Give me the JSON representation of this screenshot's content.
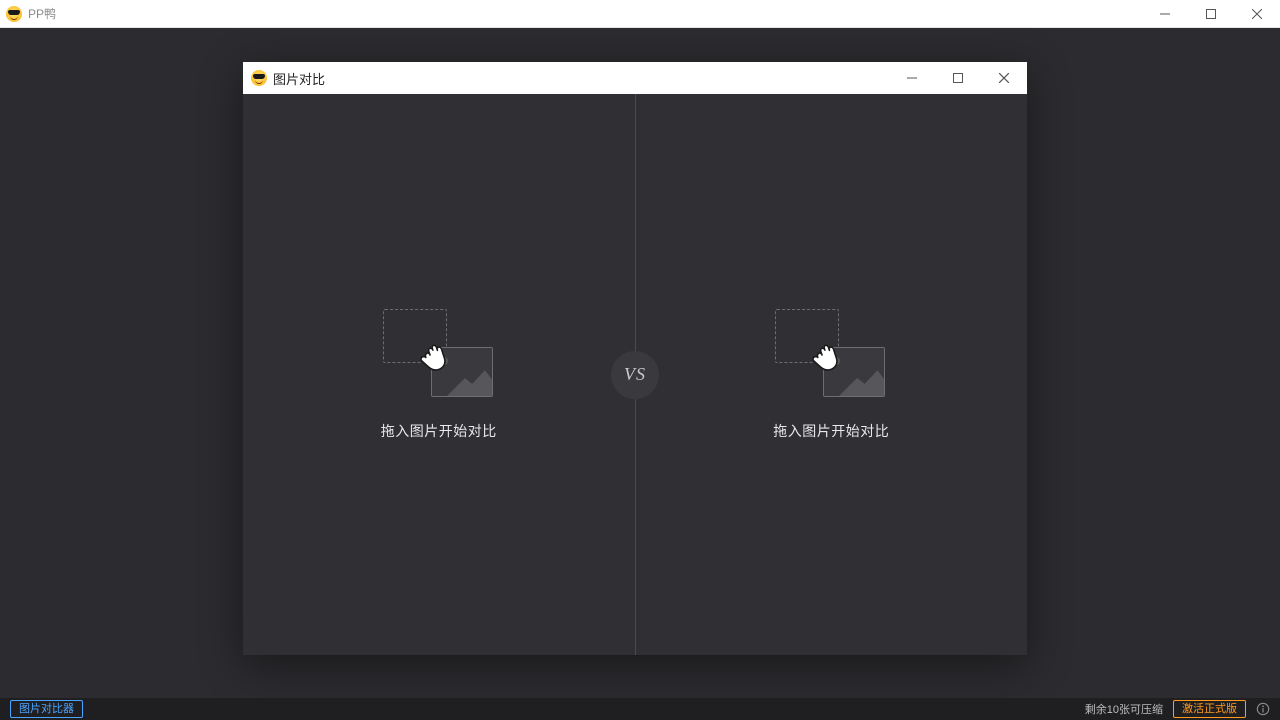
{
  "app": {
    "title": "PP鸭"
  },
  "dialog": {
    "title": "图片对比",
    "vs_label": "VS",
    "left_drop_text": "拖入图片开始对比",
    "right_drop_text": "拖入图片开始对比"
  },
  "footer": {
    "comparator_label": "图片对比器",
    "remaining_text": "剩余10张可压缩",
    "activate_label": "激活正式版"
  }
}
